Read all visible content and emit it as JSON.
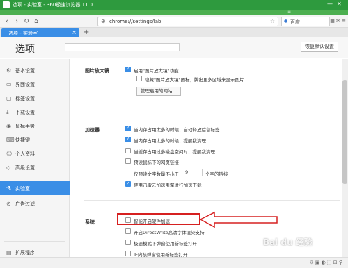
{
  "window": {
    "title": "选项 - 实验室 - 360极速浏览器 11.0"
  },
  "toolbar": {
    "url": "chrome://settings/lab",
    "search_engine": "百度"
  },
  "tabstrip": {
    "tab_label": "选项 - 实验室",
    "new_tab": "+"
  },
  "header": {
    "title": "选项",
    "reset_label": "恢复默认设置"
  },
  "sidebar": {
    "items": [
      {
        "label": "基本设置",
        "icon": "gear-icon"
      },
      {
        "label": "界面设置",
        "icon": "layout-icon"
      },
      {
        "label": "标签设置",
        "icon": "tab-icon"
      },
      {
        "label": "下载设置",
        "icon": "download-icon"
      },
      {
        "label": "鼠标手势",
        "icon": "mouse-icon"
      },
      {
        "label": "快捷键",
        "icon": "keyboard-icon"
      },
      {
        "label": "个人资料",
        "icon": "user-icon"
      },
      {
        "label": "高级设置",
        "icon": "shield-icon"
      },
      {
        "label": "实验室",
        "icon": "flask-icon",
        "active": true
      },
      {
        "label": "广告过滤",
        "icon": "block-icon"
      }
    ],
    "footer": "扩展程序"
  },
  "image_zoom": {
    "label": "图片放大镜",
    "enable": "启用\"图片放大镜\"功能",
    "hide": "隐藏\"图片放大镜\"图标，腾出更多区域来显示图片",
    "manage": "管理启用的网站..."
  },
  "accelerator": {
    "label": "加速器",
    "options": [
      {
        "text": "当内存占用太多的时候，自动释放后台标签",
        "checked": true
      },
      {
        "text": "当内存占用太多的时候，提醒我清理",
        "checked": true
      },
      {
        "text": "当缓存占用过多磁盘空间时，提醒我清理",
        "checked": false
      },
      {
        "text": "预读鼠标下的网页链接",
        "checked": false
      }
    ],
    "prefetch_prefix": "仅预读文字数量不小于",
    "prefetch_value": "9",
    "prefetch_suffix": "个字的链接",
    "thunder": "使用迅雷云加速引擎进行加速下载"
  },
  "system": {
    "label": "系统",
    "options": [
      {
        "text": "智能开启硬件加速",
        "checked": false
      },
      {
        "text": "开启DirectWrite高清字体渲染支持",
        "checked": false
      },
      {
        "text": "极速模式下弹窗使用新标签打开",
        "checked": false
      },
      {
        "text": "IE内核弹窗使用新标签打开",
        "checked": false
      }
    ]
  },
  "watermark": "Bai du 经验"
}
